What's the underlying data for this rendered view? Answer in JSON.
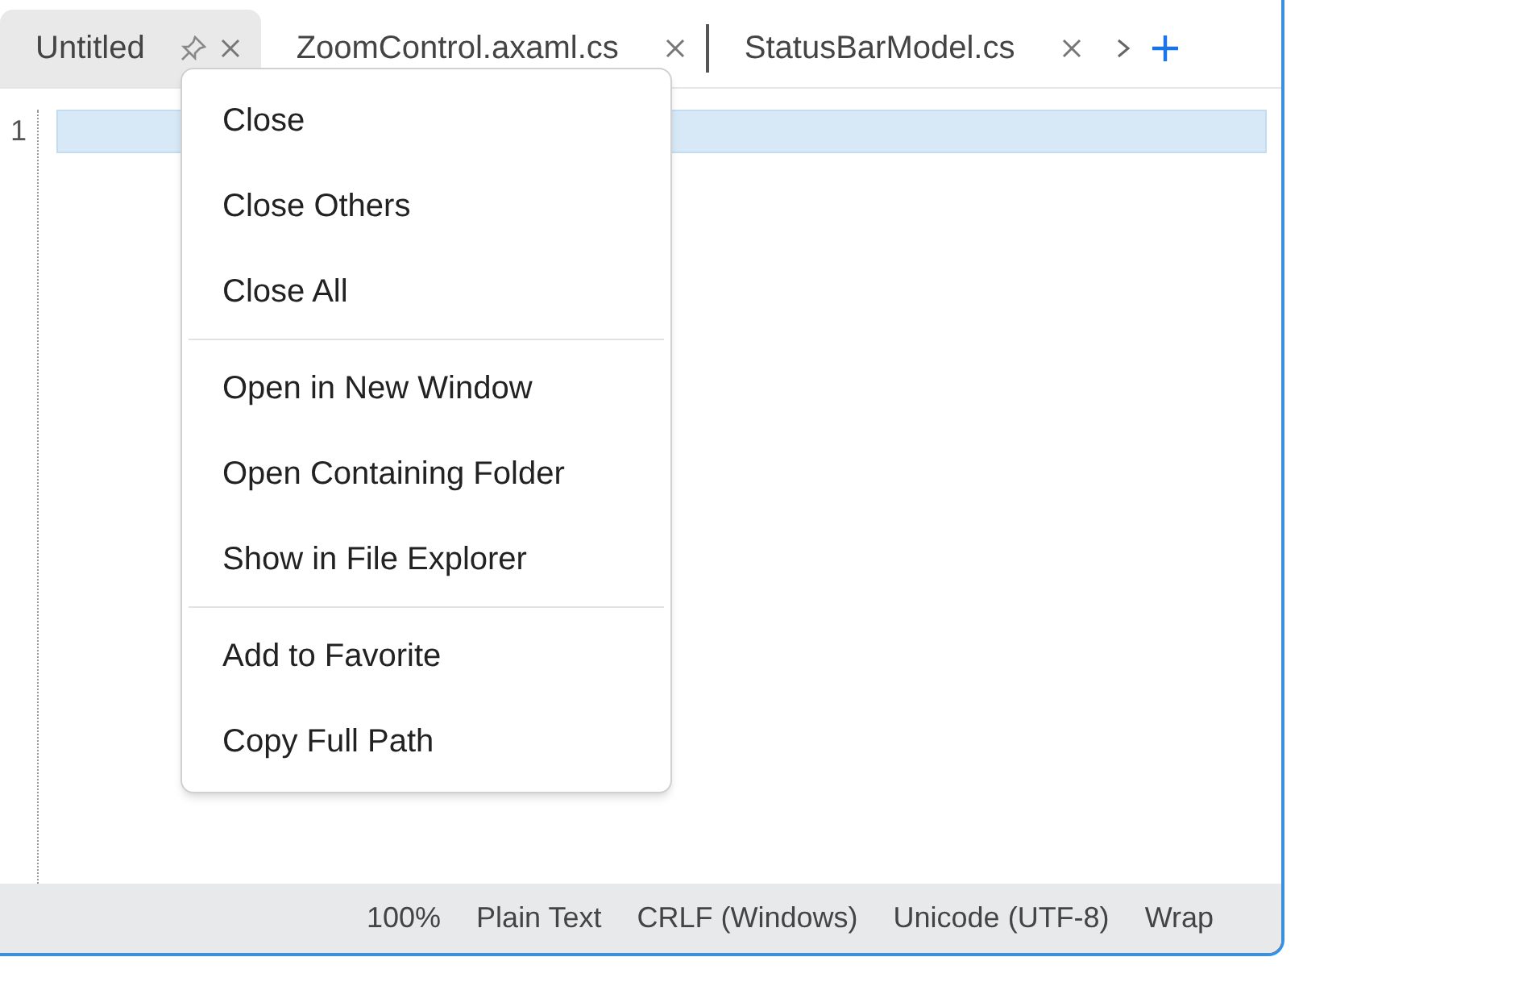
{
  "tabs": [
    {
      "label": "Untitled",
      "selected": true
    },
    {
      "label": "ZoomControl.axaml.cs",
      "selected": false
    },
    {
      "label": "StatusBarModel.cs",
      "selected": false
    }
  ],
  "editor": {
    "line_numbers": [
      "1"
    ]
  },
  "context_menu": [
    {
      "kind": "item",
      "label": "Close"
    },
    {
      "kind": "item",
      "label": "Close Others"
    },
    {
      "kind": "item",
      "label": "Close All"
    },
    {
      "kind": "separator"
    },
    {
      "kind": "item",
      "label": "Open in New Window"
    },
    {
      "kind": "item",
      "label": "Open Containing Folder"
    },
    {
      "kind": "item",
      "label": "Show in File Explorer"
    },
    {
      "kind": "separator"
    },
    {
      "kind": "item",
      "label": "Add to Favorite"
    },
    {
      "kind": "item",
      "label": "Copy Full Path"
    }
  ],
  "status_bar": [
    "100%",
    "Plain Text",
    "CRLF (Windows)",
    "Unicode (UTF-8)",
    "Wrap"
  ]
}
